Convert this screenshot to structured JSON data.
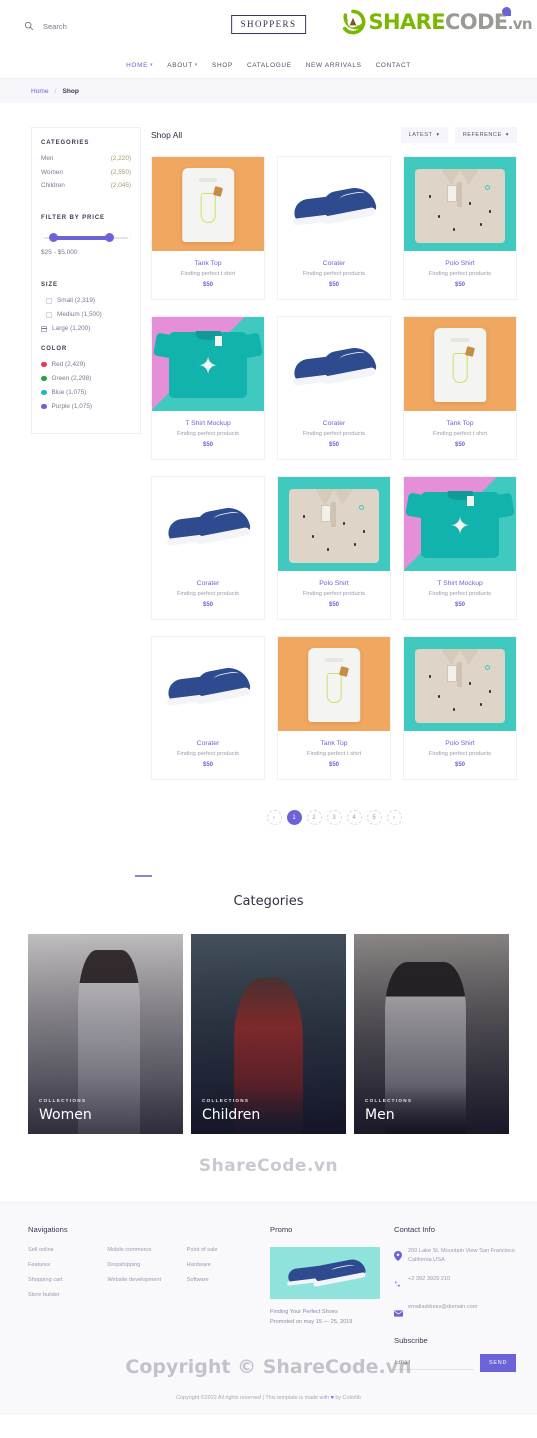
{
  "header": {
    "search_placeholder": "Search",
    "search_value": "",
    "search_icon": "search-icon",
    "brand": "SHOPPERS",
    "watermark": {
      "share": "SHARE",
      "code": "CODE",
      "tld": ".vn"
    }
  },
  "nav": {
    "items": [
      {
        "label": "HOME",
        "caret": "▾",
        "active": true
      },
      {
        "label": "ABOUT",
        "caret": "▾",
        "active": false
      },
      {
        "label": "SHOP",
        "caret": "",
        "active": false
      },
      {
        "label": "CATALOGUE",
        "caret": "",
        "active": false
      },
      {
        "label": "NEW ARRIVALS",
        "caret": "",
        "active": false
      },
      {
        "label": "CONTACT",
        "caret": "",
        "active": false
      }
    ]
  },
  "breadcrumb": {
    "home": "Home",
    "separator": "/",
    "current": "Shop"
  },
  "sidebar": {
    "categories_title": "CATEGORIES",
    "categories": [
      {
        "label": "Men",
        "count": "(2,220)"
      },
      {
        "label": "Women",
        "count": "(2,550)"
      },
      {
        "label": "Children",
        "count": "(2,045)"
      }
    ],
    "price_title": "FILTER BY PRICE",
    "price_range": "$25 - $5,000",
    "size_title": "SIZE",
    "sizes": [
      {
        "label": "Small (2,319)",
        "checked": false
      },
      {
        "label": "Medium (1,500)",
        "checked": false
      },
      {
        "label": "Large (1,200)",
        "checked": true
      }
    ],
    "color_title": "COLOR",
    "colors": [
      {
        "label": "Red (2,429)",
        "hex": "#e8384f"
      },
      {
        "label": "Green (2,298)",
        "hex": "#22a447"
      },
      {
        "label": "Blue (1,075)",
        "hex": "#1fb6c9"
      },
      {
        "label": "Purple (1,075)",
        "hex": "#6c63d8"
      }
    ]
  },
  "shop": {
    "title": "Shop All",
    "sorts": [
      {
        "label": "LATEST",
        "caret": "▾"
      },
      {
        "label": "REFERENCE",
        "caret": "▾"
      }
    ],
    "products": [
      {
        "name": "Tank Top",
        "desc": "Finding perfect t shirt",
        "price": "$50",
        "art": "tank"
      },
      {
        "name": "Corater",
        "desc": "Finding perfect products",
        "price": "$50",
        "art": "shoe"
      },
      {
        "name": "Polo Shirt",
        "desc": "Finding perfect products",
        "price": "$50",
        "art": "polo"
      },
      {
        "name": "T Shirt Mockup",
        "desc": "Finding perfect products",
        "price": "$50",
        "art": "tee"
      },
      {
        "name": "Corater",
        "desc": "Finding perfect products",
        "price": "$50",
        "art": "shoe"
      },
      {
        "name": "Tank Top",
        "desc": "Finding perfect t shirt",
        "price": "$50",
        "art": "tank"
      },
      {
        "name": "Corater",
        "desc": "Finding perfect products",
        "price": "$50",
        "art": "shoe"
      },
      {
        "name": "Polo Shirt",
        "desc": "Finding perfect products",
        "price": "$50",
        "art": "polo"
      },
      {
        "name": "T Shirt Mockup",
        "desc": "Finding perfect products",
        "price": "$50",
        "art": "tee"
      },
      {
        "name": "Corater",
        "desc": "Finding perfect products",
        "price": "$50",
        "art": "shoe"
      },
      {
        "name": "Tank Top",
        "desc": "Finding perfect t shirt",
        "price": "$50",
        "art": "tank"
      },
      {
        "name": "Polo Shirt",
        "desc": "Finding perfect products",
        "price": "$50",
        "art": "polo"
      }
    ],
    "pagination": [
      {
        "label": "‹",
        "active": false
      },
      {
        "label": "1",
        "active": true
      },
      {
        "label": "2",
        "active": false
      },
      {
        "label": "3",
        "active": false
      },
      {
        "label": "4",
        "active": false
      },
      {
        "label": "5",
        "active": false
      },
      {
        "label": "›",
        "active": false
      }
    ]
  },
  "categories_section": {
    "title": "Categories",
    "cards": [
      {
        "kicker": "COLLECTIONS",
        "name": "Women",
        "art": "ph-women"
      },
      {
        "kicker": "COLLECTIONS",
        "name": "Children",
        "art": "ph-children"
      },
      {
        "kicker": "COLLECTIONS",
        "name": "Men",
        "art": "ph-men"
      }
    ]
  },
  "mid_watermark": "ShareCode.vn",
  "footer": {
    "nav_title": "Navigations",
    "nav_col1": [
      "Sell online",
      "Features",
      "Shopping cart",
      "Store builder"
    ],
    "nav_col2": [
      "Mobile commerce",
      "Dropshipping",
      "Website development"
    ],
    "nav_col3": [
      "Point of sale",
      "Hardware",
      "Software"
    ],
    "promo_title": "Promo",
    "promo_line1": "Finding Your Perfect Shoes",
    "promo_line2": "Promoted on may 15 — 25, 2019",
    "contact_title": "Contact Info",
    "address": "200 Lake St. Mountain View San Francisco California USA",
    "phone": "+2 392 3929 210",
    "email": "emailaddress@domain.com",
    "subscribe_title": "Subscribe",
    "subscribe_placeholder": "Email",
    "subscribe_value": "",
    "send_label": "SEND",
    "copyright_pre": "Copyright ©2022 All rights reserved | This template is made with",
    "copyright_heart": "♥",
    "copyright_post": "by Colorlib",
    "watermark": "Copyright © ShareCode.vn",
    "watermark_logo": "ShareCode.vn"
  },
  "colors": {
    "accent": "#6c63d8",
    "text_dark": "#2f2f45",
    "text_muted": "#9a9ab0",
    "footer_bg": "#f9f9fc",
    "breadcrumb_bg": "#f7f7fb"
  }
}
